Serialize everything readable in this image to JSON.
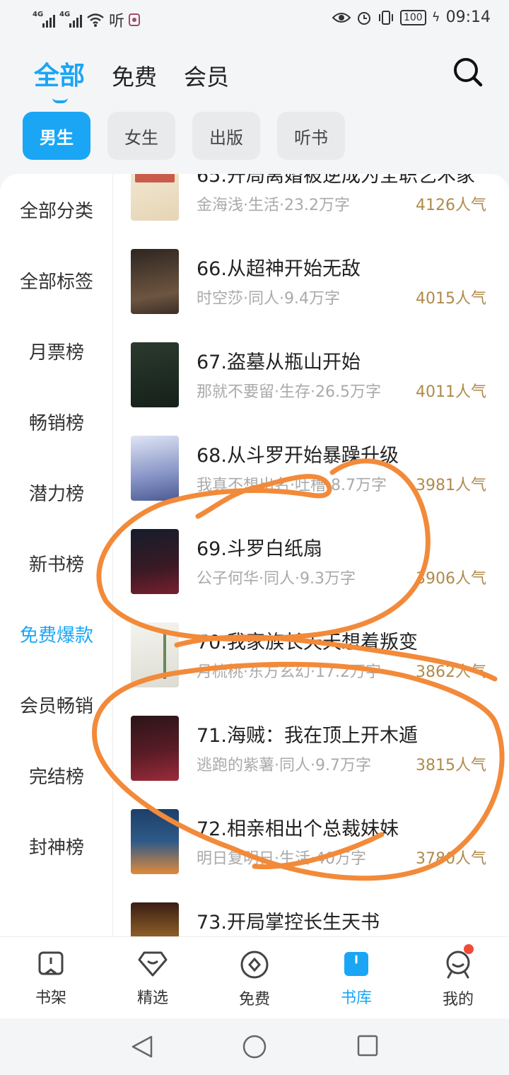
{
  "status": {
    "net1": "4G",
    "net2": "4G",
    "listen_badge": "听",
    "battery": "100",
    "time": "09:14"
  },
  "top_tabs": [
    {
      "label": "全部",
      "active": true
    },
    {
      "label": "免费",
      "active": false
    },
    {
      "label": "会员",
      "active": false
    }
  ],
  "chips": [
    {
      "label": "男生",
      "active": true
    },
    {
      "label": "女生",
      "active": false
    },
    {
      "label": "出版",
      "active": false
    },
    {
      "label": "听书",
      "active": false
    }
  ],
  "sidenav": [
    {
      "label": "全部分类",
      "active": false
    },
    {
      "label": "全部标签",
      "active": false
    },
    {
      "label": "月票榜",
      "active": false
    },
    {
      "label": "畅销榜",
      "active": false
    },
    {
      "label": "潜力榜",
      "active": false
    },
    {
      "label": "新书榜",
      "active": false
    },
    {
      "label": "免费爆款",
      "active": true
    },
    {
      "label": "会员畅销",
      "active": false
    },
    {
      "label": "完结榜",
      "active": false
    },
    {
      "label": "封神榜",
      "active": false
    }
  ],
  "books": [
    {
      "title": "65.开局离婚被逆成为全职艺术家",
      "meta": "金海浅·生活·23.2万字",
      "popularity": "4126人气",
      "cover": [
        "#efe6d2",
        "#c0392b"
      ]
    },
    {
      "title": "66.从超神开始无敌",
      "meta": "时空莎·同人·9.4万字",
      "popularity": "4015人气",
      "cover": [
        "#3a2e26",
        "#8e6b4a"
      ]
    },
    {
      "title": "67.盗墓从瓶山开始",
      "meta": "那就不要留·生存·26.5万字",
      "popularity": "4011人气",
      "cover": [
        "#1e2a22",
        "#3f5a44"
      ]
    },
    {
      "title": "68.从斗罗开始暴躁升级",
      "meta": "我真不想出名·吐槽·8.7万字",
      "popularity": "3981人气",
      "cover": [
        "#c9d3ea",
        "#6f7fb8"
      ]
    },
    {
      "title": "69.斗罗白纸扇",
      "meta": "公子何华·同人·9.3万字",
      "popularity": "3906人气",
      "cover": [
        "#141a2a",
        "#6b1d2a"
      ]
    },
    {
      "title": "70.我家族长天天想着叛变",
      "meta": "月梳桃·东方玄幻·17.2万字",
      "popularity": "3862人气",
      "cover": [
        "#f1f1ec",
        "#6a8a5a"
      ]
    },
    {
      "title": "71.海贼：我在顶上开木遁",
      "meta": "逃跑的紫薯·同人·9.7万字",
      "popularity": "3815人气",
      "cover": [
        "#2a1518",
        "#9b2b3a"
      ]
    },
    {
      "title": "72.相亲相出个总裁妹妹",
      "meta": "明日复明日·生活·40万字",
      "popularity": "3780人气",
      "cover": [
        "#1d3f6a",
        "#e08a3a"
      ]
    },
    {
      "title": "73.开局掌控长生天书",
      "meta": "",
      "popularity": "",
      "cover": [
        "#3a1d14",
        "#d89a3a"
      ]
    }
  ],
  "bottom_nav": [
    {
      "label": "书架",
      "icon": "bookshelf-icon",
      "active": false
    },
    {
      "label": "精选",
      "icon": "diamond-icon",
      "active": false
    },
    {
      "label": "免费",
      "icon": "free-icon",
      "active": false
    },
    {
      "label": "书库",
      "icon": "library-icon",
      "active": true
    },
    {
      "label": "我的",
      "icon": "profile-icon",
      "active": false,
      "badge": true
    }
  ],
  "colors": {
    "accent": "#1aa6f5",
    "popularity": "#b08a4a",
    "annotation": "#f28a3a",
    "badge": "#f04a3a"
  }
}
